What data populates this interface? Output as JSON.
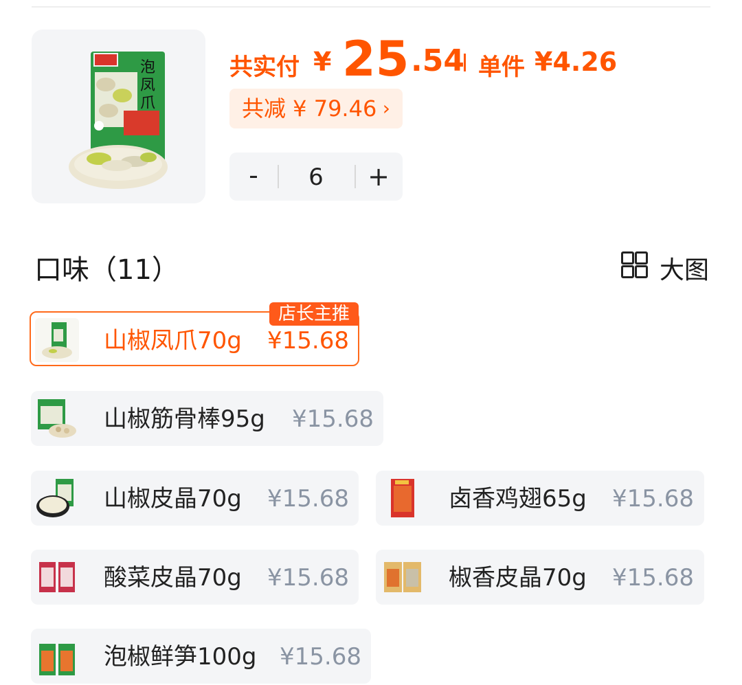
{
  "product": {
    "pay_label": "共实付",
    "currency": "¥",
    "price_integer": "25",
    "price_decimal": ".54",
    "unit_label": "单件",
    "unit_price": "¥4.26",
    "discount_text": "共减 ¥ 79.46",
    "discount_chevron": "›",
    "image_icon": "chicken-feet-package-icon"
  },
  "stepper": {
    "minus": "-",
    "quantity": "6",
    "plus": "+"
  },
  "flavors": {
    "title": "口味（11）",
    "view_toggle_label": "大图",
    "badge": "店长主推",
    "options": [
      {
        "name": "山椒凤爪70g",
        "price": "¥15.68",
        "selected": true
      },
      {
        "name": "山椒筋骨棒95g",
        "price": "¥15.68",
        "selected": false
      },
      {
        "name": "山椒皮晶70g",
        "price": "¥15.68",
        "selected": false
      },
      {
        "name": "卤香鸡翅65g",
        "price": "¥15.68",
        "selected": false
      },
      {
        "name": "酸菜皮晶70g",
        "price": "¥15.68",
        "selected": false
      },
      {
        "name": "椒香皮晶70g",
        "price": "¥15.68",
        "selected": false
      },
      {
        "name": "泡椒鲜笋100g",
        "price": "¥15.68",
        "selected": false
      }
    ]
  },
  "colors": {
    "accent": "#ff5500",
    "muted_price": "#8a94a3",
    "chip_bg": "#f4f5f7",
    "discount_bg": "#fff0e6"
  }
}
